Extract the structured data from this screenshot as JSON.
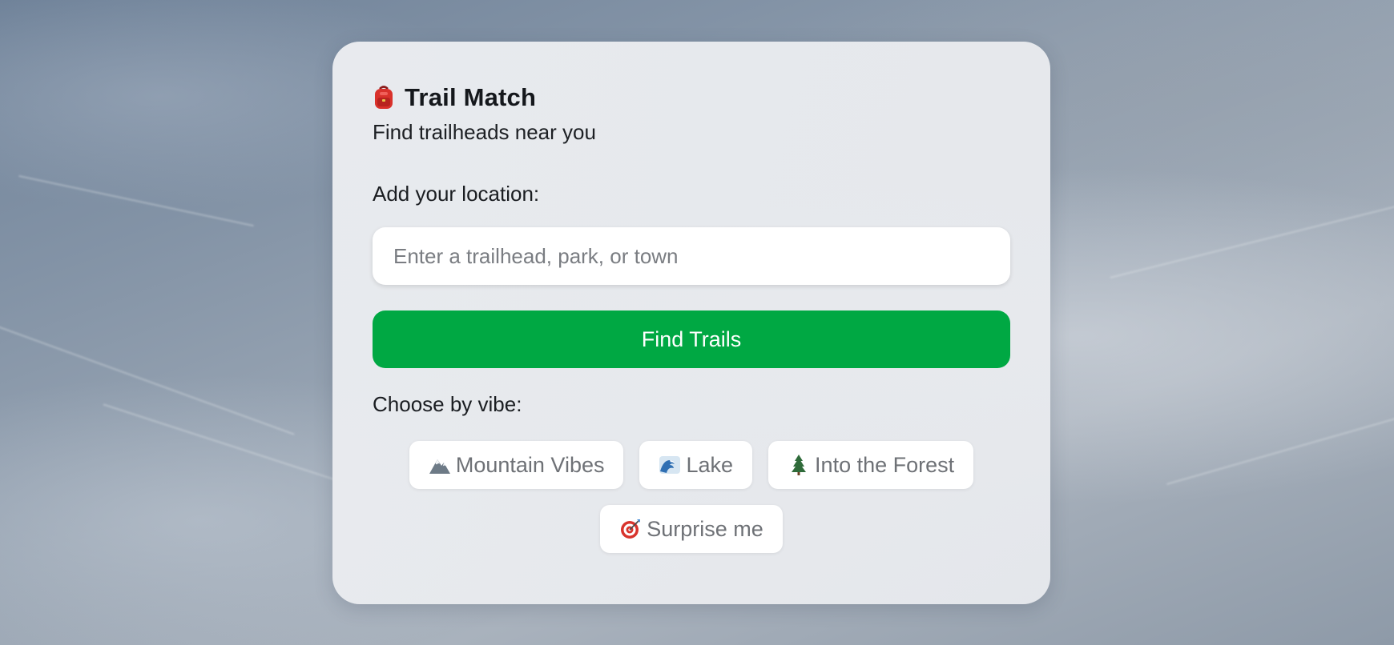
{
  "app": {
    "icon": "backpack-icon",
    "title": "Trail Match",
    "subtitle": "Find trailheads near you"
  },
  "location": {
    "label": "Add your location:",
    "placeholder": "Enter a trailhead, park, or town",
    "value": ""
  },
  "find_button": {
    "label": "Find Trails",
    "color": "#00a843"
  },
  "vibes": {
    "label": "Choose by vibe:",
    "options": [
      {
        "icon": "mountain-icon",
        "label": "Mountain Vibes"
      },
      {
        "icon": "wave-icon",
        "label": "Lake"
      },
      {
        "icon": "evergreen-tree-icon",
        "label": "Into the Forest"
      },
      {
        "icon": "target-icon",
        "label": "Surprise me"
      }
    ]
  }
}
